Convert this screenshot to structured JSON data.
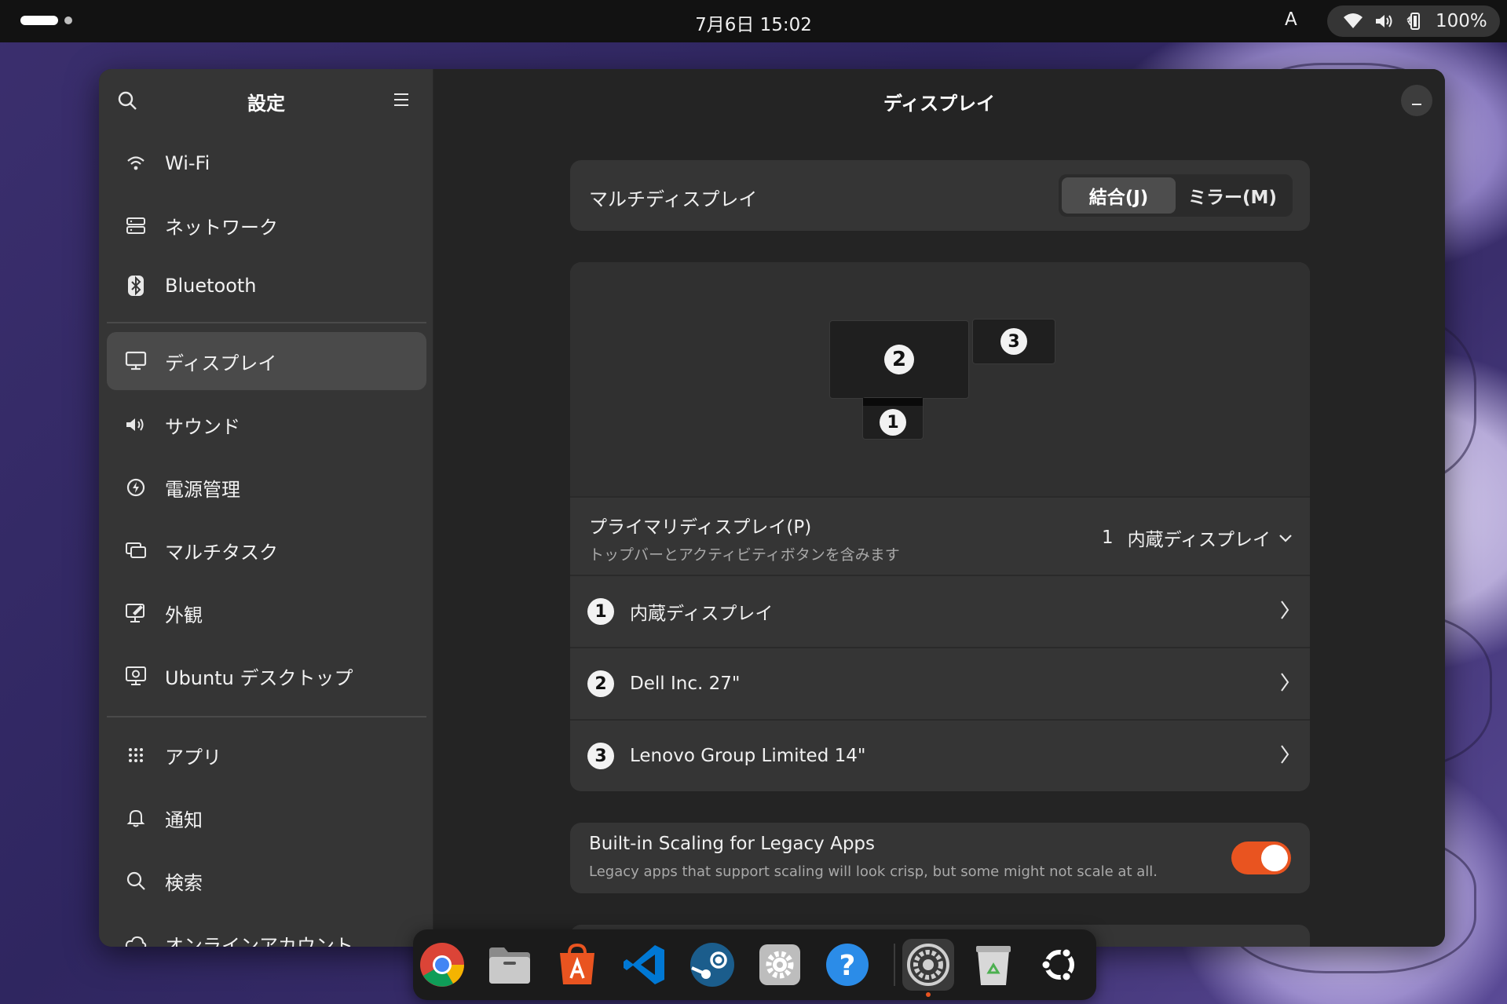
{
  "topbar": {
    "clock": "7月6日  15:02",
    "input_source": "A",
    "battery_percent": "100%",
    "icons": [
      "wifi-icon",
      "volume-icon",
      "battery-icon"
    ]
  },
  "sidebar": {
    "title": "設定",
    "items": [
      {
        "label": "Wi-Fi",
        "icon": "wifi-icon"
      },
      {
        "label": "ネットワーク",
        "icon": "network-icon"
      },
      {
        "label": "Bluetooth",
        "icon": "bluetooth-icon"
      },
      {
        "label": "ディスプレイ",
        "icon": "display-icon",
        "active": true
      },
      {
        "label": "サウンド",
        "icon": "speaker-icon"
      },
      {
        "label": "電源管理",
        "icon": "power-icon"
      },
      {
        "label": "マルチタスク",
        "icon": "multitask-icon"
      },
      {
        "label": "外観",
        "icon": "appearance-icon"
      },
      {
        "label": "Ubuntu デスクトップ",
        "icon": "ubuntu-desktop-icon"
      },
      {
        "label": "アプリ",
        "icon": "apps-grid-icon"
      },
      {
        "label": "通知",
        "icon": "bell-icon"
      },
      {
        "label": "検索",
        "icon": "search-icon"
      },
      {
        "label": "オンラインアカウント",
        "icon": "cloud-icon"
      }
    ]
  },
  "main": {
    "title": "ディスプレイ",
    "multi_display": {
      "label": "マルチディスプレイ",
      "join_label": "結合(J)",
      "mirror_label": "ミラー(M)",
      "selected": "結合(J)"
    },
    "arrangement": {
      "monitors": [
        {
          "number": "1",
          "primary": true
        },
        {
          "number": "2"
        },
        {
          "number": "3"
        }
      ]
    },
    "primary_display": {
      "label": "プライマリディスプレイ(P)",
      "subtitle": "トップバーとアクティビティボタンを含みます",
      "value_number": "1",
      "value_name": "内蔵ディスプレイ"
    },
    "displays": [
      {
        "number": "1",
        "name": "内蔵ディスプレイ"
      },
      {
        "number": "2",
        "name": "Dell Inc. 27\""
      },
      {
        "number": "3",
        "name": "Lenovo Group Limited 14\""
      }
    ],
    "legacy_scaling": {
      "title": "Built-in Scaling for Legacy Apps",
      "subtitle": "Legacy apps that support scaling will look crisp, but some might not scale at all.",
      "enabled": true
    }
  },
  "dock": {
    "apps": [
      "chrome-icon",
      "files-icon",
      "app-center-icon",
      "vscode-icon",
      "steam-icon",
      "settings-gear-icon",
      "help-icon",
      "system-settings-icon",
      "trash-icon",
      "ubuntu-logo-icon"
    ],
    "running": "system-settings-icon"
  },
  "colors": {
    "accent": "#e95420",
    "topbar": "#121212",
    "sidebar": "#353535",
    "main_bg": "#242424",
    "card": "#353535"
  }
}
